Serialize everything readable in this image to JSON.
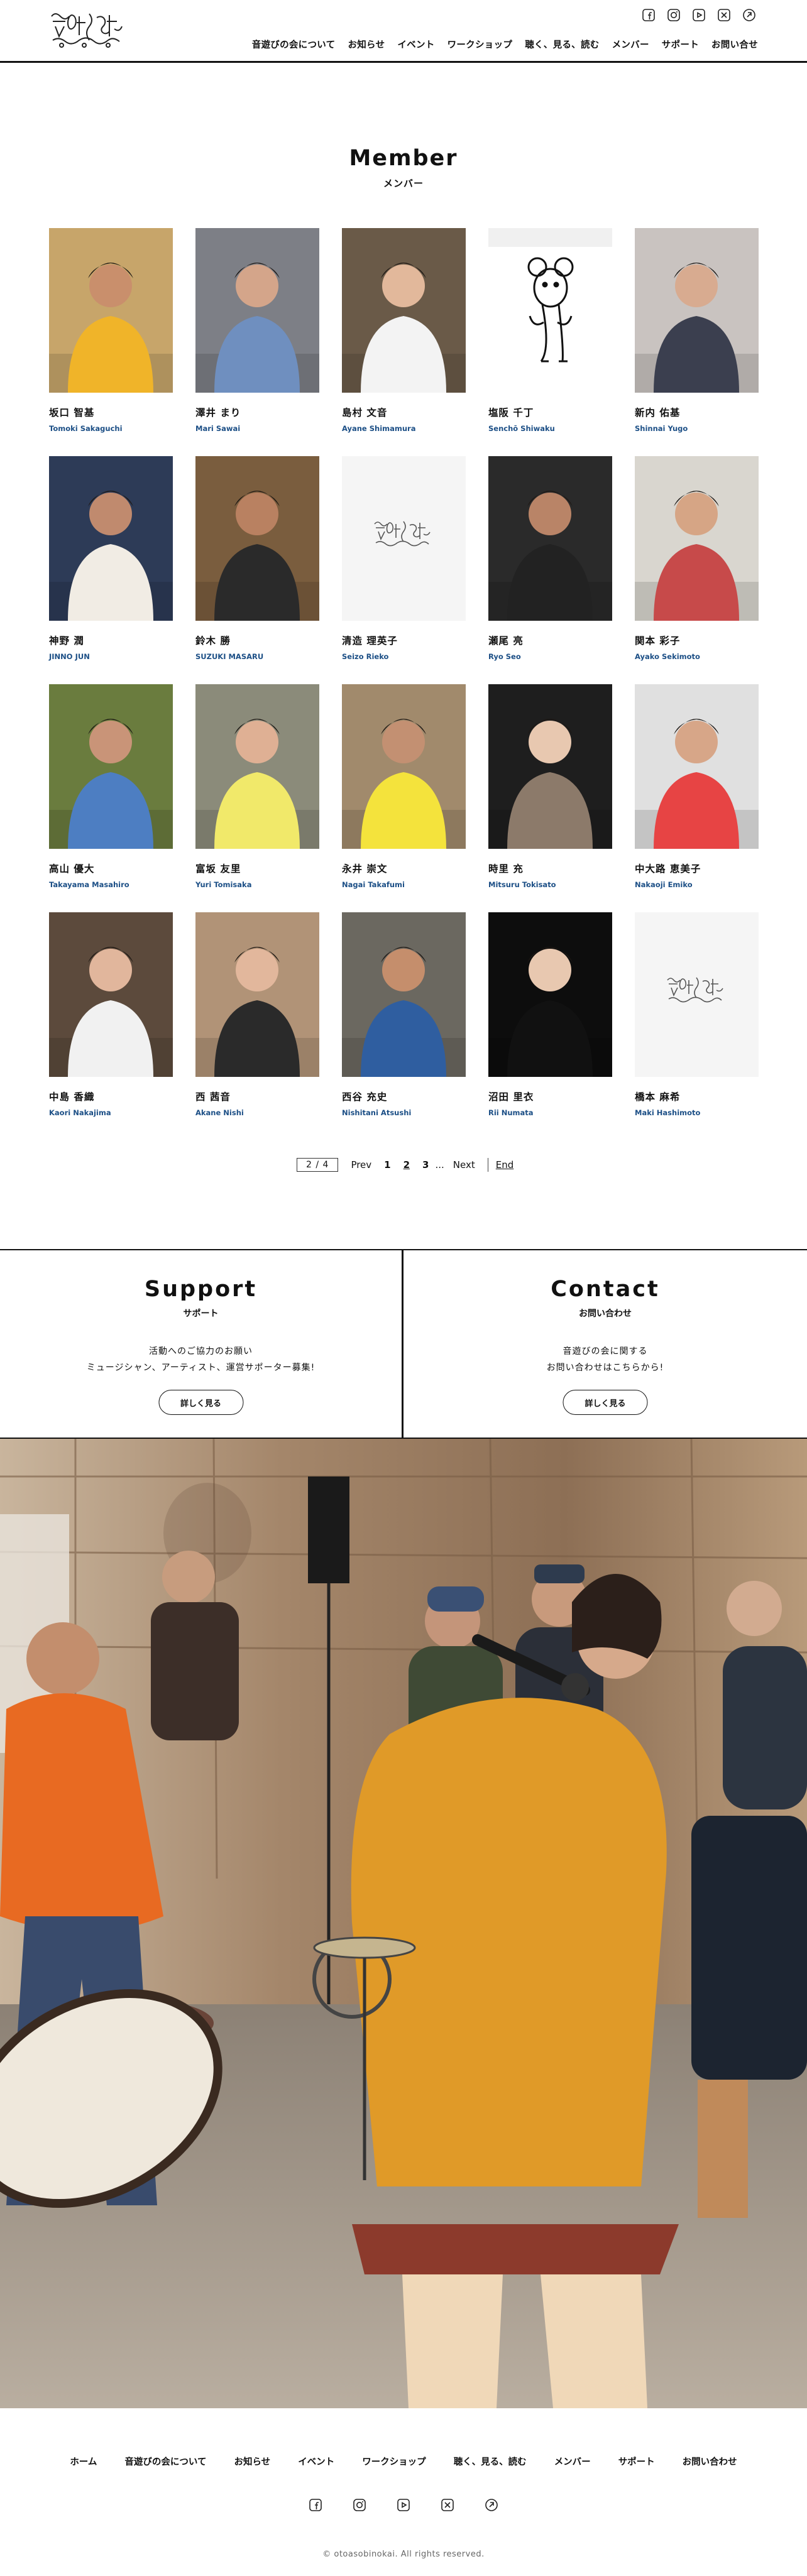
{
  "site": {
    "logo_alt": "音遊びの会",
    "social_icons": [
      "facebook-icon",
      "instagram-icon",
      "youtube-icon",
      "x-icon",
      "link-icon"
    ]
  },
  "nav": {
    "items": [
      "音遊びの会について",
      "お知らせ",
      "イベント",
      "ワークショップ",
      "聴く、見る、読む",
      "メンバー",
      "サポート",
      "お問い合せ"
    ]
  },
  "section": {
    "title_en": "Member",
    "title_ja": "メンバー"
  },
  "members": [
    {
      "ja": "坂口 智基",
      "en": "Tomoki Sakaguchi"
    },
    {
      "ja": "澤井 まり",
      "en": "Mari Sawai"
    },
    {
      "ja": "島村 文音",
      "en": "Ayane Shimamura"
    },
    {
      "ja": "塩阪 千丁",
      "en": "Senchō Shiwaku"
    },
    {
      "ja": "新内 佑基",
      "en": "Shinnai Yugo"
    },
    {
      "ja": "神野 潤",
      "en": "JINNO JUN"
    },
    {
      "ja": "鈴木 勝",
      "en": "SUZUKI MASARU"
    },
    {
      "ja": "清造 理英子",
      "en": "Seizo Rieko"
    },
    {
      "ja": "瀬尾 亮",
      "en": "Ryo Seo"
    },
    {
      "ja": "関本 彩子",
      "en": "Ayako Sekimoto"
    },
    {
      "ja": "高山 優大",
      "en": "Takayama Masahiro"
    },
    {
      "ja": "富坂 友里",
      "en": "Yuri Tomisaka"
    },
    {
      "ja": "永井 崇文",
      "en": "Nagai Takafumi"
    },
    {
      "ja": "時里 充",
      "en": "Mitsuru Tokisato"
    },
    {
      "ja": "中大路 恵美子",
      "en": "Nakaoji Emiko"
    },
    {
      "ja": "中島 香織",
      "en": "Kaori Nakajima"
    },
    {
      "ja": "西 茜音",
      "en": "Akane Nishi"
    },
    {
      "ja": "西谷 充史",
      "en": "Nishitani Atsushi"
    },
    {
      "ja": "沼田 里衣",
      "en": "Rii Numata"
    },
    {
      "ja": "橋本 麻希",
      "en": "Maki Hashimoto"
    }
  ],
  "pagination": {
    "current": "2 / 4",
    "prev": "Prev",
    "pages": [
      "1",
      "2",
      "3"
    ],
    "ellipsis": "...",
    "next": "Next",
    "end": "End",
    "active_page": 2
  },
  "support": {
    "title_en": "Support",
    "title_ja": "サポート",
    "line1": "活動へのご協力のお願い",
    "line2": "ミュージシャン、アーティスト、運営サポーター募集!",
    "button": "詳しく見る"
  },
  "contact": {
    "title_en": "Contact",
    "title_ja": "お問い合わせ",
    "line1": "音遊びの会に関する",
    "line2": "お問い合わせはこちらから!",
    "button": "詳しく見る"
  },
  "footer": {
    "nav": [
      "ホーム",
      "音遊びの会について",
      "お知らせ",
      "イベント",
      "ワークショップ",
      "聴く、見る、読む",
      "メンバー",
      "サポート",
      "お問い合わせ"
    ],
    "copyright": "© otoasobinokai. All rights reserved."
  },
  "colors": {
    "name_en": "#1c4f86",
    "line": "#111111"
  }
}
